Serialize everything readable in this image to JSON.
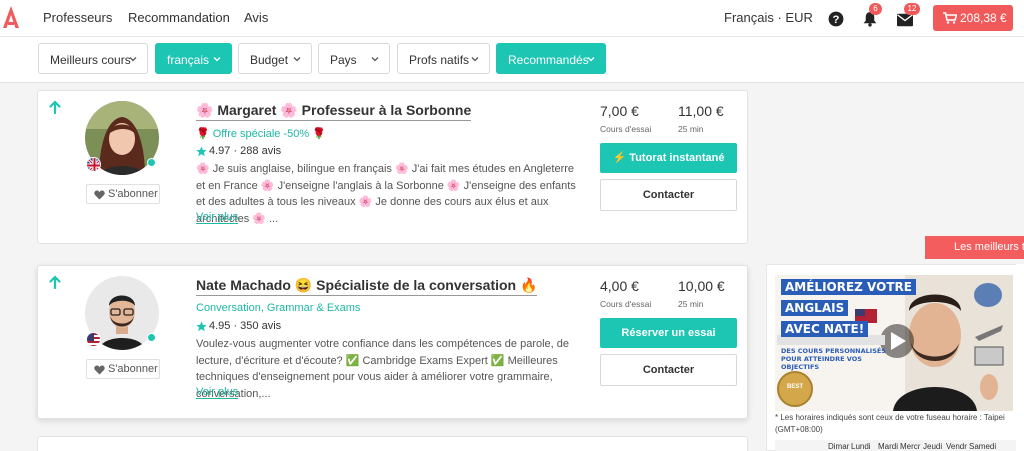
{
  "brand": {
    "accent": "#1dc5b3",
    "red": "#f05a5a"
  },
  "nav": {
    "links": [
      "Professeurs",
      "Recommandation",
      "Avis"
    ],
    "lang_currency": "Français · EUR",
    "help_icon": "question-circle-icon",
    "notif_count": "6",
    "msg_count": "12",
    "cart_total": "208,38 €"
  },
  "filters": [
    {
      "label": "Meilleurs cours",
      "active": false
    },
    {
      "label": "français",
      "active": true
    },
    {
      "label": "Budget",
      "active": false
    },
    {
      "label": "Pays",
      "active": false
    },
    {
      "label": "Profs natifs",
      "active": false
    },
    {
      "label": "Recommandés",
      "active": true
    }
  ],
  "tutors": [
    {
      "name": "🌸 Margaret 🌸 Professeur à la Sorbonne",
      "tagline": "🌹 Offre spéciale -50% 🌹",
      "rating": "4.97 · 288 avis",
      "description": "🌸 Je suis anglaise, bilingue en français 🌸 J'ai fait mes études en Angleterre et en France 🌸 J'enseigne l'anglais à la Sorbonne 🌸 J'enseigne des enfants et des adultes à tous les niveaux 🌸 Je donne des cours aux élus et aux architectes 🌸 ...",
      "more": "Voir plus",
      "subscribe": "S'abonner",
      "price_trial": "7,00 €",
      "price_trial_label": "Cours d'essai",
      "price_regular": "11,00 €",
      "price_regular_label": "25 min",
      "primary_button": "⚡ Tutorat instantané",
      "secondary_button": "Contacter",
      "flag": "uk-flag-icon"
    },
    {
      "name": "Nate Machado 😆 Spécialiste de la conversation 🔥",
      "tagline": "Conversation, Grammar & Exams",
      "rating": "4.95 · 350 avis",
      "description": "Voulez-vous augmenter votre confiance dans les compétences de parole, de lecture, d'écriture et d'écoute? ✅ Cambridge Exams Expert ✅ Meilleures techniques d'enseignement pour vous aider à améliorer votre grammaire, conversation,...",
      "more": "Voir plus",
      "subscribe": "S'abonner",
      "price_trial": "4,00 €",
      "price_trial_label": "Cours d'essai",
      "price_regular": "10,00 €",
      "price_regular_label": "25 min",
      "primary_button": "Réserver un essai",
      "secondary_button": "Contacter",
      "flag": "us-flag-icon"
    }
  ],
  "sidebar": {
    "banner": "Les meilleurs tu",
    "video_lines": [
      "AMÉLIOREZ VOTRE",
      "ANGLAIS",
      "AVEC NATE!"
    ],
    "video_sub": "DES COURS PERSONNALISÉS POUR ATTEINDRE VOS OBJECTIFS",
    "badge": "BEST",
    "timezone_note": "* Les horaires indiqués sont ceux de votre fuseau horaire : Taipei (GMT+08:00)",
    "days": [
      "Dimar",
      "Lundi",
      "Mardi",
      "Mercr",
      "Jeudi",
      "Vendr",
      "Samedi"
    ]
  }
}
